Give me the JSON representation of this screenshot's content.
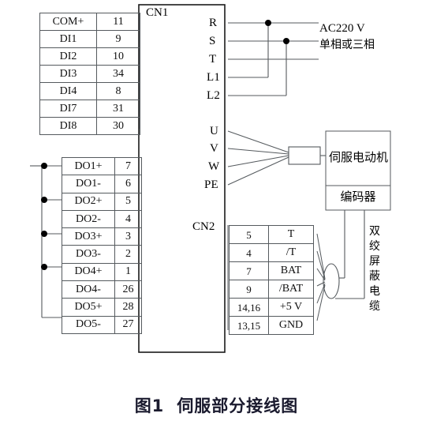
{
  "figure": {
    "caption_number": "图1",
    "caption_title": "伺服部分接线图"
  },
  "drive": {
    "cn1_label": "CN1",
    "cn2_label": "CN2"
  },
  "cn1_table": {
    "rows": [
      {
        "name": "COM+",
        "pin": "11"
      },
      {
        "name": "DI1",
        "pin": "9"
      },
      {
        "name": "DI2",
        "pin": "10"
      },
      {
        "name": "DI3",
        "pin": "34"
      },
      {
        "name": "DI4",
        "pin": "8"
      },
      {
        "name": "DI7",
        "pin": "31"
      },
      {
        "name": "DI8",
        "pin": "30"
      }
    ]
  },
  "do_table": {
    "rows": [
      {
        "name": "DO1+",
        "pin": "7"
      },
      {
        "name": "DO1-",
        "pin": "6"
      },
      {
        "name": "DO2+",
        "pin": "5"
      },
      {
        "name": "DO2-",
        "pin": "4"
      },
      {
        "name": "DO3+",
        "pin": "3"
      },
      {
        "name": "DO3-",
        "pin": "2"
      },
      {
        "name": "DO4+",
        "pin": "1"
      },
      {
        "name": "DO4-",
        "pin": "26"
      },
      {
        "name": "DO5+",
        "pin": "28"
      },
      {
        "name": "DO5-",
        "pin": "27"
      }
    ]
  },
  "power_terminals": {
    "labels": [
      "R",
      "S",
      "T",
      "L1",
      "L2"
    ]
  },
  "motor_terminals": {
    "labels": [
      "U",
      "V",
      "W",
      "PE"
    ]
  },
  "ac_note": {
    "line1": "AC220 V",
    "line2": "单相或三相"
  },
  "motor": {
    "body_label": "伺服电动机",
    "encoder_label": "编码器"
  },
  "cn2_table": {
    "rows": [
      {
        "pin": "5",
        "signal": "T"
      },
      {
        "pin": "4",
        "signal": "/T"
      },
      {
        "pin": "7",
        "signal": "BAT"
      },
      {
        "pin": "9",
        "signal": "/BAT"
      },
      {
        "pin": "14,16",
        "signal": "+5 V"
      },
      {
        "pin": "13,15",
        "signal": "GND"
      }
    ]
  },
  "cable_note": {
    "text": "双绞屏蔽电缆"
  },
  "colors": {
    "line": "#555a5e",
    "heavy_line": "#1a1a1a",
    "text": "#111111",
    "caption": "#1a1a2e",
    "background": "#ffffff"
  }
}
